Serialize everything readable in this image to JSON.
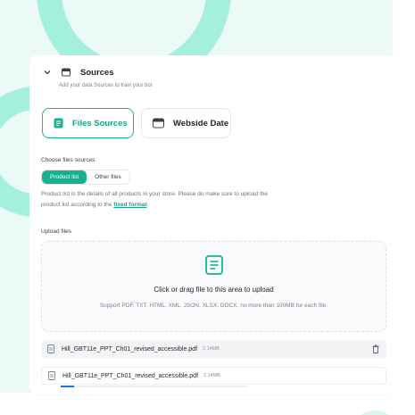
{
  "section": {
    "title": "Sources",
    "subtitle": "Add your data Sources to train your bot"
  },
  "tiles": {
    "files": "Files Sources",
    "website": "Webside Date"
  },
  "choose": {
    "label": "Choose files sources",
    "options": [
      "Product list",
      "Other files"
    ],
    "selected": "Product list"
  },
  "description": {
    "text1": "Product list is the details of all products in your store. Please do make sure to upload the",
    "text2": "product list according to the ",
    "link": "fixed format",
    "text3": "."
  },
  "upload": {
    "label": "Upload files",
    "title": "Click or drag file to this area to upload",
    "hint": "Support PDF, TXT, HTML, XML, JSON, XLSX, DOCX, no more than 100MB for each file."
  },
  "files": [
    {
      "name": "Hill_GBT11e_PPT_Ch01_revised_accessible.pdf",
      "size": "2.14MB",
      "progress": 1.0
    },
    {
      "name": "Hill_GBT11e_PPT_Ch01_revised_accessible.pdf",
      "size": "2.14MB",
      "progress": 0.07
    }
  ],
  "colors": {
    "accent": "#17b191",
    "backdrop": "#ebfaf7",
    "progress": "#1a73e8"
  }
}
